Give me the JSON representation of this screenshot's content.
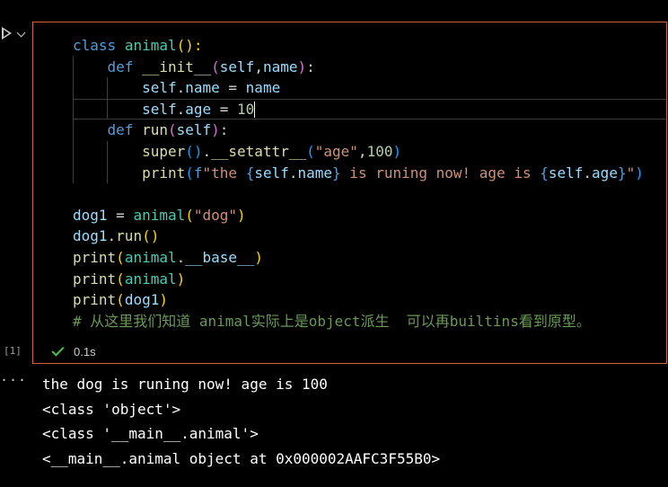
{
  "cell": {
    "execution_count": "[1]",
    "status_time": "0.1s",
    "code": {
      "l1": {
        "kw": "class",
        "name": "animal",
        "rest": "():"
      },
      "l2": {
        "kw": "def",
        "name": "__init__",
        "p_open": "(",
        "self": "self",
        "comma": ",",
        "arg": "name",
        "p_close": ")",
        "colon": ":"
      },
      "l3": {
        "obj": "self",
        "dot": ".",
        "attr": "name",
        "eq": " = ",
        "val": "name"
      },
      "l4": {
        "obj": "self",
        "dot": ".",
        "attr": "age",
        "eq": " = ",
        "val": "10"
      },
      "l5": {
        "kw": "def",
        "name": "run",
        "p_open": "(",
        "self": "self",
        "p_close": ")",
        "colon": ":"
      },
      "l6": {
        "fn": "super",
        "parens": "()",
        "dot": ".",
        "method": "__setattr__",
        "p_open": "(",
        "str": "\"age\"",
        "comma": ",",
        "num": "100",
        "p_close": ")"
      },
      "l7": {
        "fn": "print",
        "p_open": "(",
        "prefix": "f",
        "s1": "\"the ",
        "b1o": "{",
        "e1": "self",
        "e1dot": ".",
        "e1attr": "name",
        "b1c": "}",
        "s2": " is runing now! age is ",
        "b2o": "{",
        "e2": "self",
        "e2dot": ".",
        "e2attr": "age",
        "b2c": "}",
        "s3": "\"",
        "p_close": ")"
      },
      "l9": {
        "var": "dog1",
        "eq": " = ",
        "cls": "animal",
        "p_open": "(",
        "str": "\"dog\"",
        "p_close": ")"
      },
      "l10": {
        "var": "dog1",
        "dot": ".",
        "fn": "run",
        "parens": "()"
      },
      "l11": {
        "fn": "print",
        "p_open": "(",
        "cls": "animal",
        "dot": ".",
        "attr": "__base__",
        "p_close": ")"
      },
      "l12": {
        "fn": "print",
        "p_open": "(",
        "cls": "animal",
        "p_close": ")"
      },
      "l13": {
        "fn": "print",
        "p_open": "(",
        "var": "dog1",
        "p_close": ")"
      },
      "l14": {
        "comment": "# 从这里我们知道 animal实际上是object派生  可以再builtins看到原型。"
      }
    }
  },
  "output": {
    "toggle": "···",
    "lines": [
      "the dog is runing now! age is 100",
      "<class 'object'>",
      "<class '__main__.animal'>",
      "<__main__.animal object at 0x000002AAFC3F55B0>"
    ]
  },
  "colors": {
    "cell_border": "#d0633a",
    "keyword": "#569cd6",
    "function": "#dcdcaa",
    "class": "#4ec9b0",
    "variable": "#9cdcfe",
    "string": "#ce9178",
    "number": "#b5cea8",
    "comment": "#6a9955",
    "success": "#4ec24e"
  },
  "icons": {
    "run": "play-icon",
    "expand": "chevron-down-icon",
    "status": "check-icon",
    "output_menu": "ellipsis-icon"
  }
}
